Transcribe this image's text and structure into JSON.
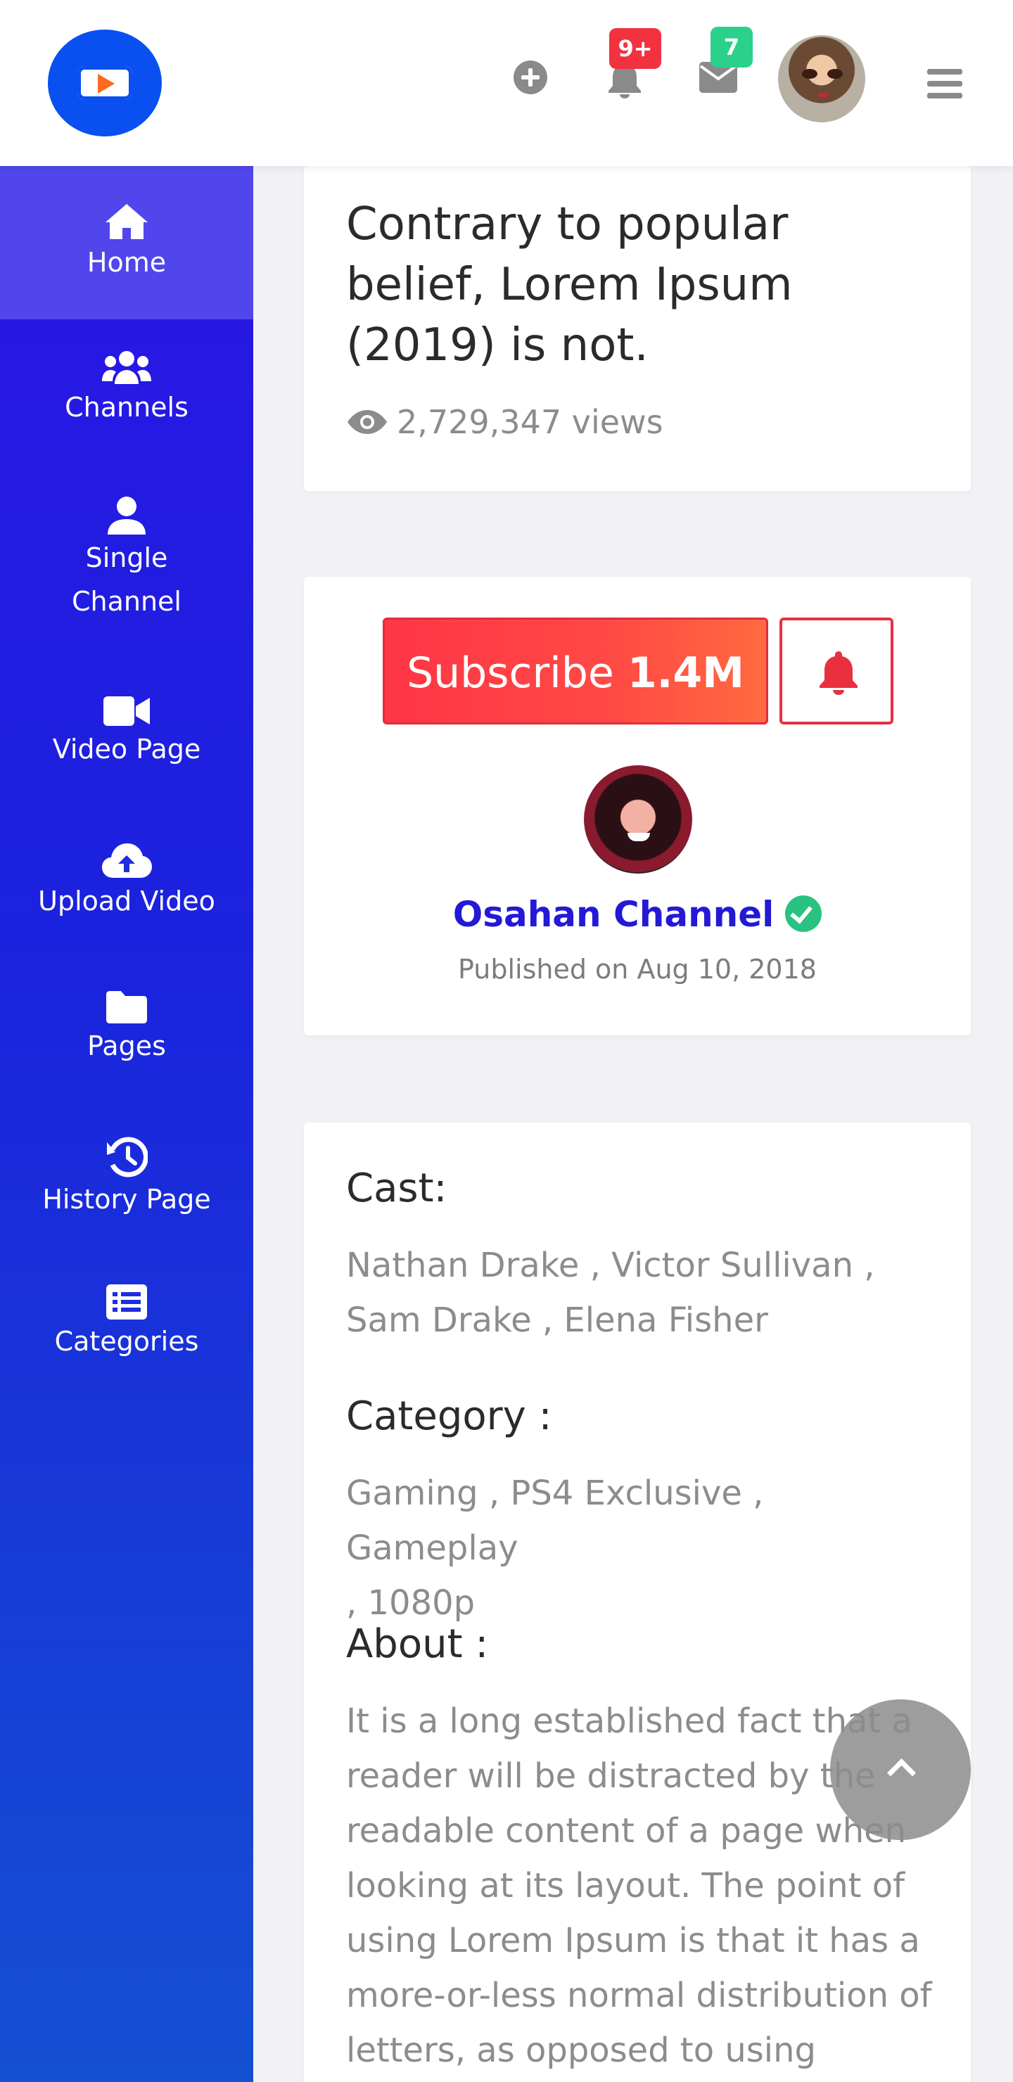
{
  "header": {
    "notifications_badge": "9+",
    "messages_badge": "7",
    "icons": [
      "logo-play-icon",
      "plus-circle-icon",
      "bell-icon",
      "envelope-icon",
      "user-avatar",
      "hamburger-menu-icon"
    ]
  },
  "sidebar": {
    "items": [
      {
        "label": "Home",
        "icon": "home-icon",
        "active": true
      },
      {
        "label": "Channels",
        "icon": "users-icon"
      },
      {
        "label": "Single Channel",
        "label_lines": [
          "Single",
          "Channel"
        ],
        "icon": "user-icon"
      },
      {
        "label": "Video Page",
        "icon": "video-camera-icon"
      },
      {
        "label": "Upload Video",
        "icon": "cloud-upload-icon"
      },
      {
        "label": "Pages",
        "icon": "folder-icon"
      },
      {
        "label": "History Page",
        "icon": "history-icon"
      },
      {
        "label": "Categories",
        "icon": "list-alt-icon"
      }
    ]
  },
  "video": {
    "title": "Contrary to popular belief, Lorem Ipsum (2019) is not.",
    "views": "2,729,347 views"
  },
  "channel": {
    "subscribe_label": "Subscribe",
    "subscriber_count": "1.4M",
    "name": "Osahan Channel",
    "published": "Published on Aug 10, 2018"
  },
  "details": {
    "cast_heading": "Cast:",
    "cast_lines": [
      "Nathan Drake , Victor Sullivan ,",
      "Sam Drake , Elena Fisher"
    ],
    "category_heading": "Category :",
    "category_lines": [
      "Gaming , PS4 Exclusive , Gameplay",
      ", 1080p"
    ],
    "about_heading": "About :",
    "about_lines": [
      "It is a long established fact that a",
      "reader will be distracted by the",
      "readable content of a page when",
      "looking at its layout. The point of",
      "using Lorem Ipsum is that it has a",
      "more-or-less normal distribution of",
      "letters, as opposed to using"
    ]
  },
  "colors": {
    "sidebar_top": "#2a16e6",
    "sidebar_bottom": "#1450d2",
    "subscribe": "#ff3545",
    "channel_name": "#2319d6",
    "badge_red": "#f2323f",
    "badge_green": "#2bd18b"
  }
}
